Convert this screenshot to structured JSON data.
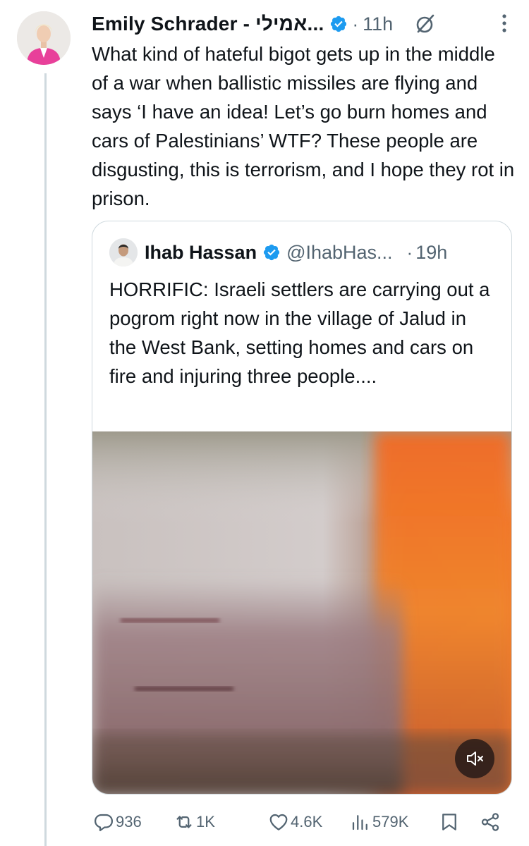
{
  "author": {
    "name": "Emily Schrader - אמילי...",
    "time": "11h"
  },
  "tweet": {
    "text": "What kind of hateful bigot gets up in the middle of a war when ballistic missiles are flying and says ‘I have an idea! Let’s go burn homes and cars of Palestinians’ WTF? These people are disgusting, this is terrorism, and I hope they rot in prison."
  },
  "quoted": {
    "name": "Ihab Hassan",
    "handle": "@IhabHas...",
    "time": "19h",
    "text": "HORRIFIC: Israeli settlers are carrying out a pogrom right now in the village of Jalud in the West Bank, setting homes and cars on fire and injuring three people...."
  },
  "actions": {
    "replies": "936",
    "reposts": "1K",
    "likes": "4.6K",
    "views": "579K"
  },
  "separator": "·",
  "icons": [
    "verified-badge-icon",
    "grok-icon",
    "more-icon",
    "mute-icon",
    "reply-icon",
    "repost-icon",
    "like-icon",
    "views-icon",
    "bookmark-icon",
    "share-icon"
  ],
  "colors": {
    "verified": "#1d9bf0",
    "secondary_text": "#536471",
    "border": "#cfd9de"
  }
}
